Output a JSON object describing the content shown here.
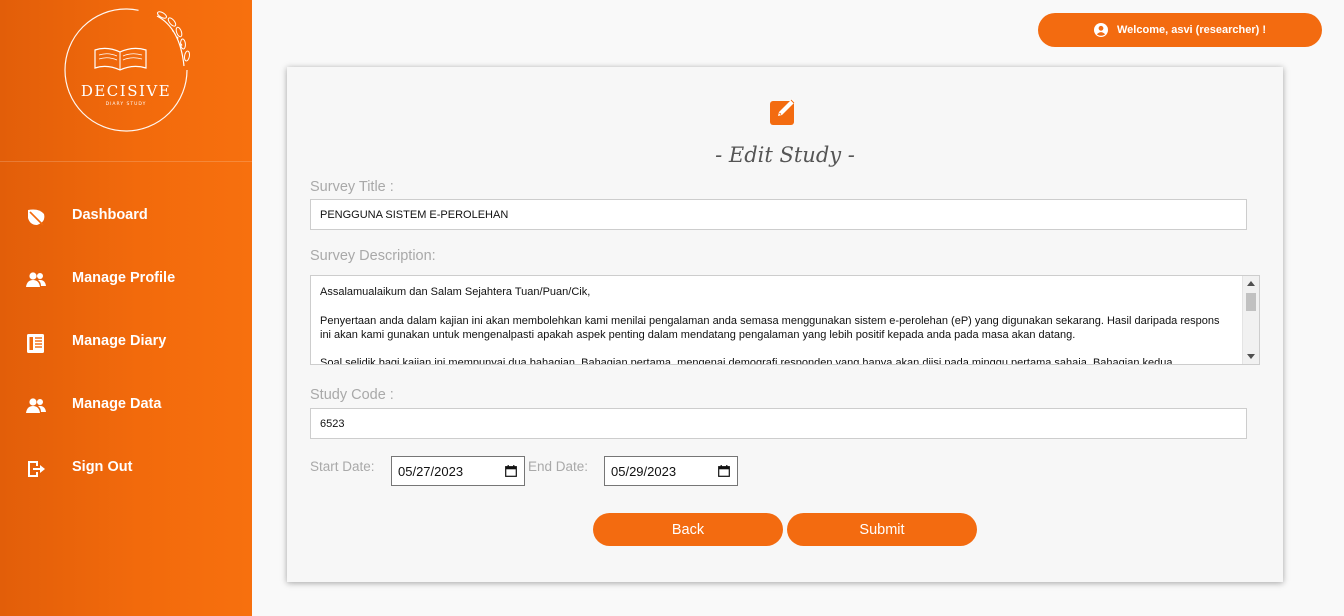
{
  "brand": {
    "logo_text": "DECISIVE",
    "logo_subtext": "DIARY STUDY"
  },
  "sidebar": {
    "items": [
      {
        "label": "Dashboard",
        "icon": "leaf-icon"
      },
      {
        "label": "Manage Profile",
        "icon": "users-icon"
      },
      {
        "label": "Manage Diary",
        "icon": "diary-icon"
      },
      {
        "label": "Manage Data",
        "icon": "users-icon"
      },
      {
        "label": "Sign Out",
        "icon": "sign-out-icon"
      }
    ]
  },
  "header": {
    "welcome": "Welcome, asvi (researcher) !"
  },
  "form": {
    "title": "- Edit Study -",
    "survey_title_label": "Survey Title :",
    "survey_title_value": "PENGGUNA SISTEM E-PEROLEHAN",
    "survey_desc_label": "Survey Description:",
    "survey_desc_lines": [
      "Assalamualaikum dan Salam Sejahtera Tuan/Puan/Cik,",
      "",
      "Penyertaan anda dalam kajian ini akan membolehkan kami menilai pengalaman anda semasa menggunakan sistem e-perolehan (eP) yang digunakan sekarang. Hasil daripada respons ini akan kami gunakan untuk mengenalpasti apakah aspek penting dalam mendatang  pengalaman yang lebih positif kepada anda  pada masa akan datang.",
      "",
      "Soal selidik bagi kajian ini mempunyai dua bahagian. Bahagian pertama, mengenai demografi responden yang hanya akan diisi pada minggu pertama sahaja. Bahagian kedua"
    ],
    "study_code_label": "Study Code :",
    "study_code_value": "6523",
    "start_date_label": "Start Date:",
    "start_date_value": "05/27/2023",
    "end_date_label": "End Date:",
    "end_date_value": "05/29/2023",
    "back_label": "Back",
    "submit_label": "Submit"
  },
  "colors": {
    "accent": "#f36b10",
    "sidebar": "#f26a0c"
  }
}
